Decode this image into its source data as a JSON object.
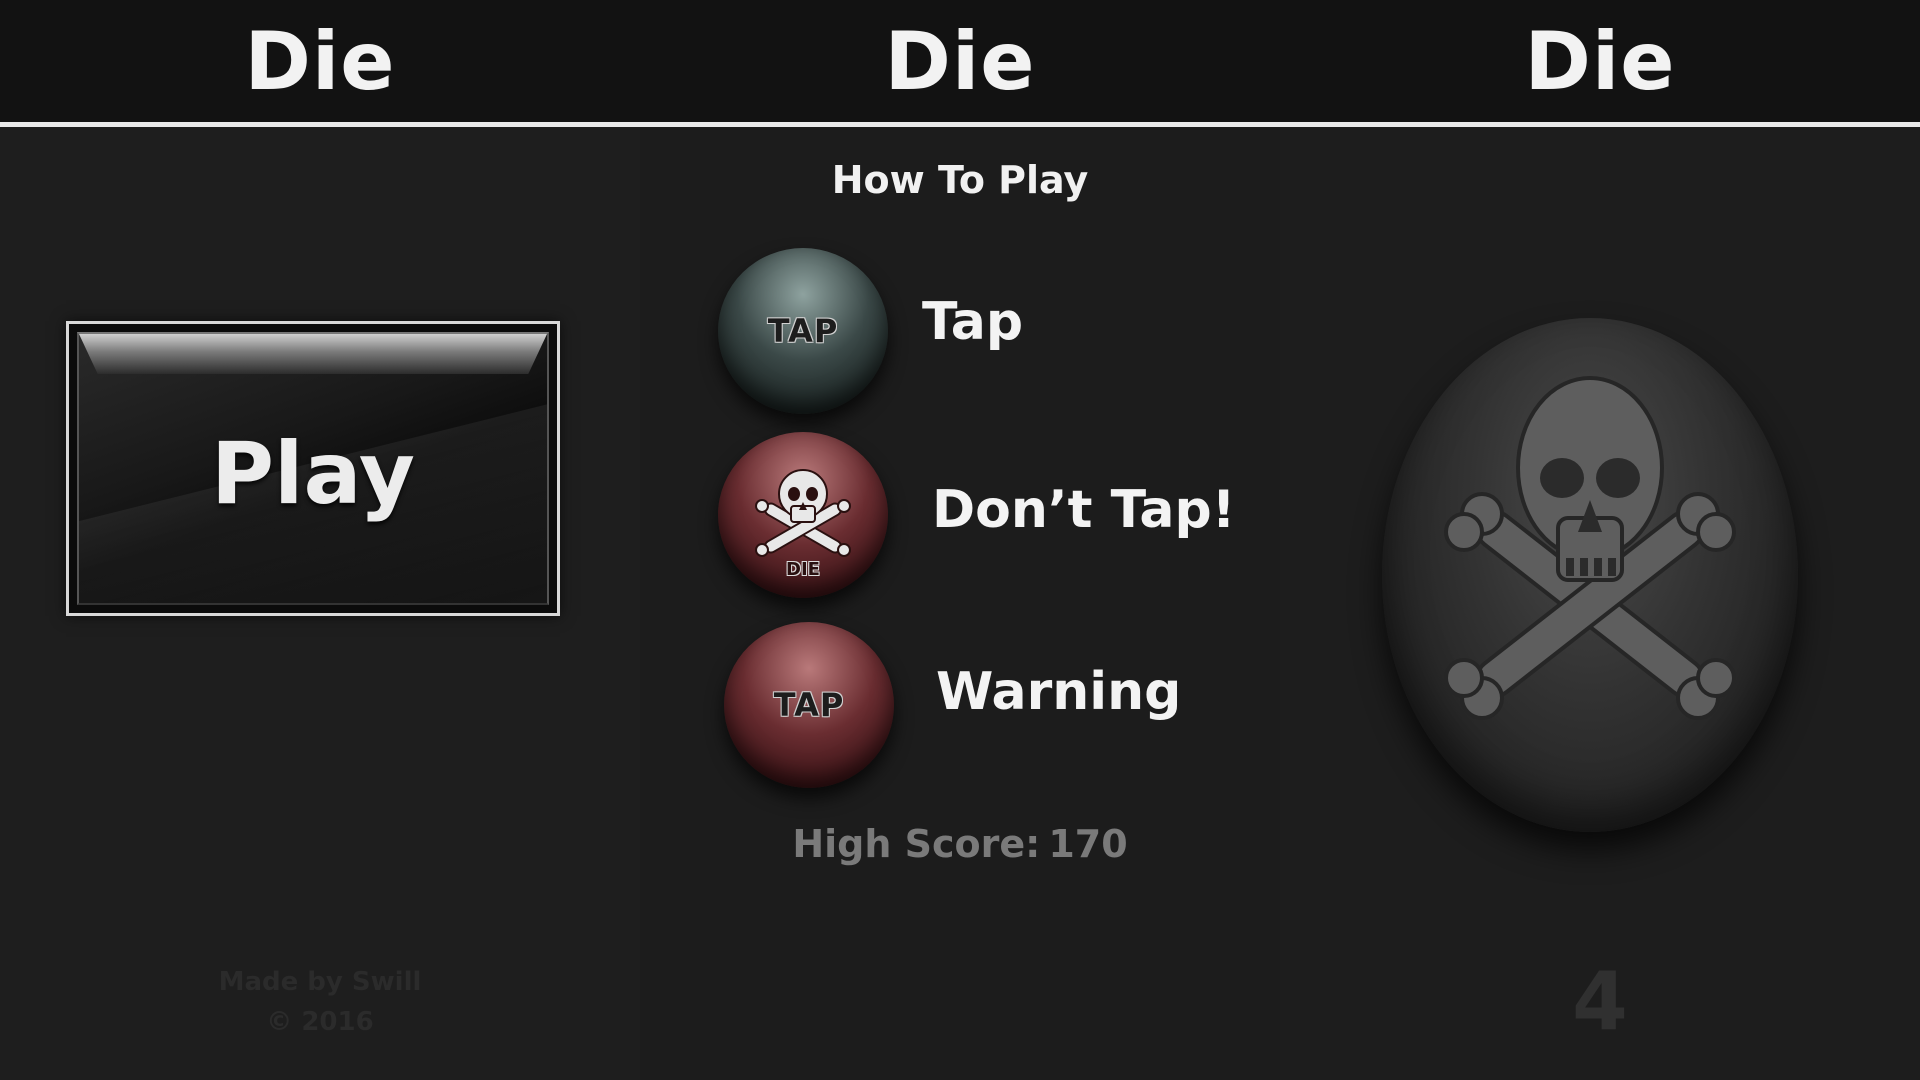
{
  "panels": {
    "left": {
      "title": "Die",
      "play_button_label": "Play",
      "credits_line1": "Made by Swill",
      "credits_line2": "© 2016"
    },
    "middle": {
      "title": "Die",
      "how_to_play": "How To Play",
      "instructions": [
        {
          "ball_text": "TAP",
          "label": "Tap",
          "icon": "green-tap-ball"
        },
        {
          "ball_text": "DIE",
          "label": "Don’t Tap!",
          "icon": "red-skull-ball"
        },
        {
          "ball_text": "TAP",
          "label": "Warning",
          "icon": "red-tap-ball"
        }
      ],
      "high_score_label": "High Score:",
      "high_score_value": "170"
    },
    "right": {
      "title": "Die",
      "counter": "4",
      "icon": "skull-crossbones-ball"
    }
  },
  "colors": {
    "background": "#1e1e1e",
    "header": "#121212",
    "header_line": "#e9e9e9",
    "tap_ball": "#3b4948",
    "danger_ball": "#6a2d31"
  }
}
